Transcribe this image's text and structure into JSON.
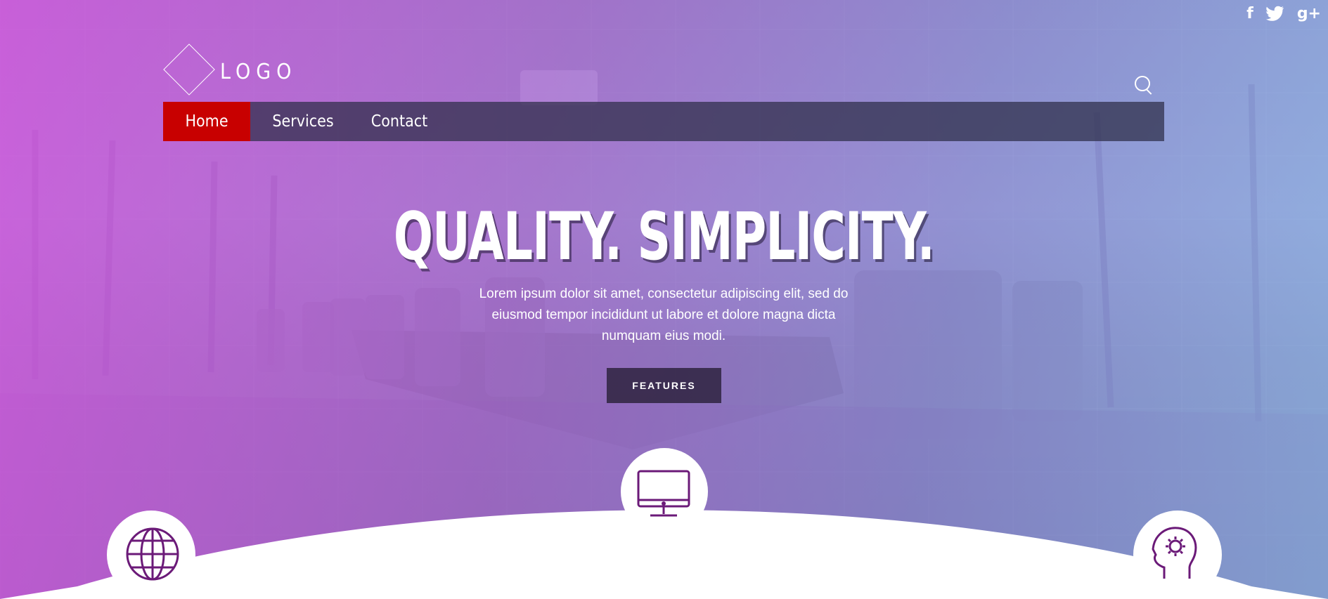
{
  "social": [
    {
      "icon": "facebook-icon",
      "glyph": "f"
    },
    {
      "icon": "twitter-icon",
      "glyph": "🐦"
    },
    {
      "icon": "google-plus-icon",
      "glyph": "g+"
    }
  ],
  "logo": {
    "text": "LOGO"
  },
  "nav": {
    "items": [
      {
        "label": "Home",
        "active": true
      },
      {
        "label": "Services"
      },
      {
        "label": "Contact"
      }
    ]
  },
  "hero": {
    "headline": "QUALITY. SIMPLICITY.",
    "subtext": "Lorem ipsum dolor sit amet, consectetur adipiscing elit, sed do eiusmod tempor incididunt ut labore et dolore magna dicta numquam eius modi.",
    "button": "FEATURES"
  },
  "colors": {
    "accent": "#c80000",
    "icon": "#6b1a78",
    "navbar": "#2d2d46"
  },
  "feature_icons": [
    "globe-icon",
    "monitor-icon",
    "head-gear-icon"
  ]
}
